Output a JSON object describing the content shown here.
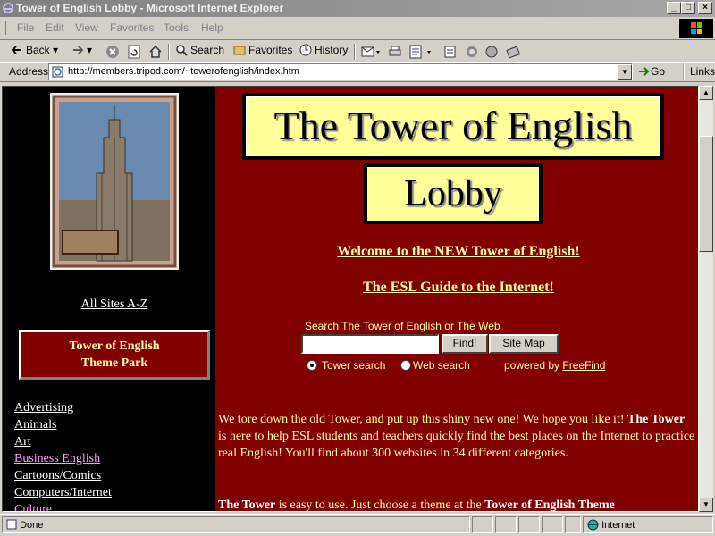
{
  "window": {
    "title": "Tower of English Lobby - Microsoft Internet Explorer",
    "controls": {
      "minimize": "_",
      "maximize": "□",
      "close": "×"
    }
  },
  "menubar": {
    "items": [
      "File",
      "Edit",
      "View",
      "Favorites",
      "Tools",
      "Help"
    ]
  },
  "toolbar": {
    "back": "Back",
    "search": "Search",
    "favorites": "Favorites",
    "history": "History"
  },
  "address": {
    "label": "Address",
    "url": "http://members.tripod.com/~towerofenglish/index.htm",
    "go": "Go",
    "links": "Links"
  },
  "page": {
    "logo_text": "Tower of English",
    "all_sites": "All Sites A-Z",
    "theme_park": {
      "line1": "Tower of English",
      "line2": "Theme Park"
    },
    "categories": [
      {
        "label": "Advertising",
        "visited": false
      },
      {
        "label": "Animals",
        "visited": false
      },
      {
        "label": "Art",
        "visited": false
      },
      {
        "label": "Business English",
        "visited": true
      },
      {
        "label": "Cartoons/Comics",
        "visited": false
      },
      {
        "label": "Computers/Internet",
        "visited": false
      },
      {
        "label": "Culture",
        "visited": true
      }
    ],
    "header1": "The Tower of English",
    "header2": "Lobby",
    "welcome_link": "Welcome to the NEW Tower of English!",
    "guide_link": "The ESL Guide to the Internet!",
    "search": {
      "label": "Search The Tower of English or The Web",
      "value": "",
      "find_button": "Find!",
      "sitemap_button": "Site Map",
      "radio_tower": "Tower search",
      "radio_web": "Web search",
      "powered_by": "powered by",
      "freefind": "FreeFind"
    },
    "para1": {
      "a": "We tore down the old Tower, and put up this shiny new one! We hope you like it! ",
      "b": "The Tower",
      "c": " is here to help ESL students and teachers quickly find the best places on the Internet to practice real English! You'll find about 300 websites in 34 different categories."
    },
    "para2": {
      "a": "The Tower",
      "b": " is easy to use. Just choose a theme at the ",
      "c": "Tower of English Theme"
    }
  },
  "status": {
    "text": "Done",
    "zone": "Internet"
  },
  "colors": {
    "page_bg": "#800000",
    "left_bg": "#000000",
    "header_bg": "#ffff99",
    "link_yellow": "#ffff99",
    "visited_link": "#ff99ff"
  }
}
